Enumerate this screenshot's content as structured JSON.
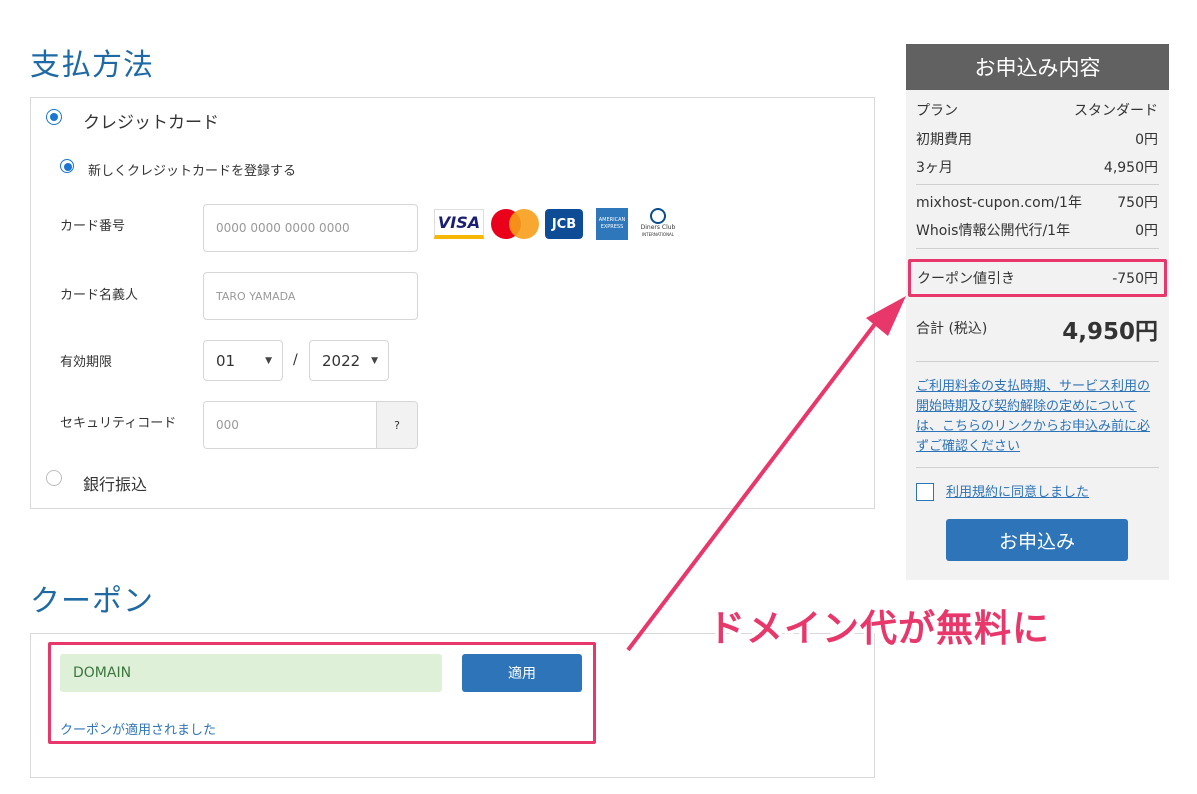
{
  "payment": {
    "title": "支払方法",
    "credit_card_label": "クレジットカード",
    "new_card_label": "新しくクレジットカードを登録する",
    "card_number_label": "カード番号",
    "card_number_placeholder": "0000 0000 0000 0000",
    "card_name_label": "カード名義人",
    "card_name_placeholder": "TARO YAMADA",
    "expiry_label": "有効期限",
    "expiry_month": "01",
    "expiry_separator": "/",
    "expiry_year": "2022",
    "security_label": "セキュリティコード",
    "security_placeholder": "000",
    "security_help": "?",
    "bank_transfer_label": "銀行振込",
    "card_brands": {
      "visa": "VISA",
      "mastercard": "mastercard",
      "jcb": "JCB",
      "amex_line1": "AMERICAN",
      "amex_line2": "EXPRESS",
      "diners_line1": "Diners Club",
      "diners_line2": "INTERNATIONAL"
    }
  },
  "coupon": {
    "title": "クーポン",
    "input_value": "DOMAIN",
    "apply_button": "適用",
    "status_message": "クーポンが適用されました"
  },
  "summary": {
    "header": "お申込み内容",
    "rows": [
      {
        "label": "プラン",
        "value": "スタンダード"
      },
      {
        "label": "初期費用",
        "value": "0円"
      },
      {
        "label": "3ヶ月",
        "value": "4,950円"
      }
    ],
    "extras": [
      {
        "label": "mixhost-cupon.com/1年",
        "value": "750円"
      },
      {
        "label": "Whois情報公開代行/1年",
        "value": "0円"
      }
    ],
    "coupon_discount_label": "クーポン値引き",
    "coupon_discount_value": "-750円",
    "total_label": "合計 (税込)",
    "total_value": "4,950円",
    "notice_link": "ご利用料金の支払時期、サービス利用の開始時期及び契約解除の定めについては、こちらのリンクからお申込み前に必ずご確認ください",
    "agree_label": "利用規約に同意しました",
    "submit_button": "お申込み"
  },
  "annotation": {
    "text": "ドメイン代が無料に"
  },
  "colors": {
    "accent_blue": "#2d74b8",
    "title_blue": "#1f6aa5",
    "highlight_pink": "#e8386b",
    "coupon_input_bg": "#dff0d8"
  }
}
